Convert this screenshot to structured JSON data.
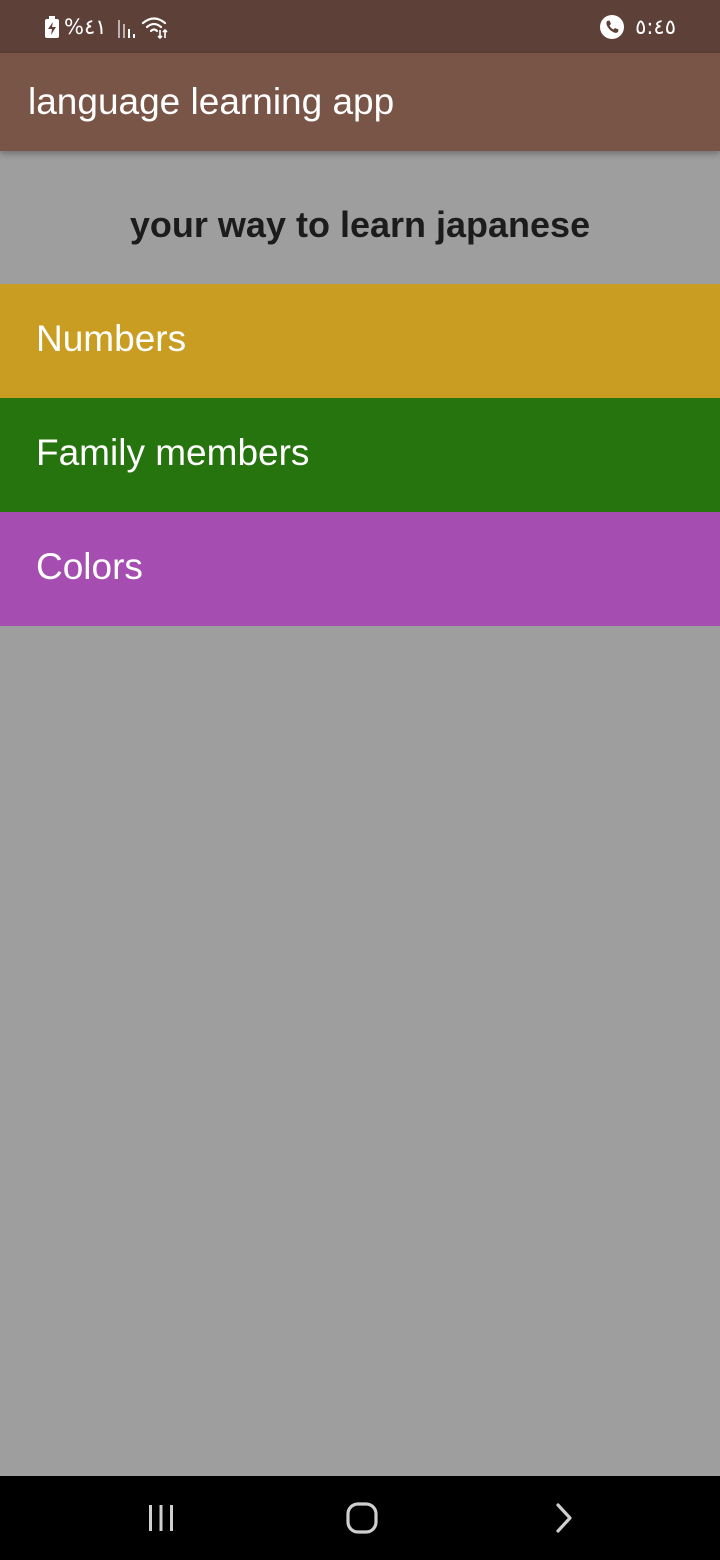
{
  "status_bar": {
    "battery_text": "%٤١",
    "time": "٥:٤٥",
    "icons": [
      "battery-charging-icon",
      "signal-icon",
      "wifi-icon",
      "call-icon"
    ]
  },
  "app_bar": {
    "title": "language learning app"
  },
  "subtitle": "your way to learn japanese",
  "categories": [
    {
      "label": "Numbers",
      "color": "#c99d21"
    },
    {
      "label": "Family members",
      "color": "#26740d"
    },
    {
      "label": "Colors",
      "color": "#a54db1"
    }
  ],
  "colors": {
    "status_bar": "#5d4037",
    "app_bar": "#795548",
    "background": "#9e9e9e",
    "nav_bar": "#000000"
  },
  "nav_bar": {
    "icons": [
      "recent-apps-icon",
      "home-icon",
      "back-icon"
    ]
  }
}
